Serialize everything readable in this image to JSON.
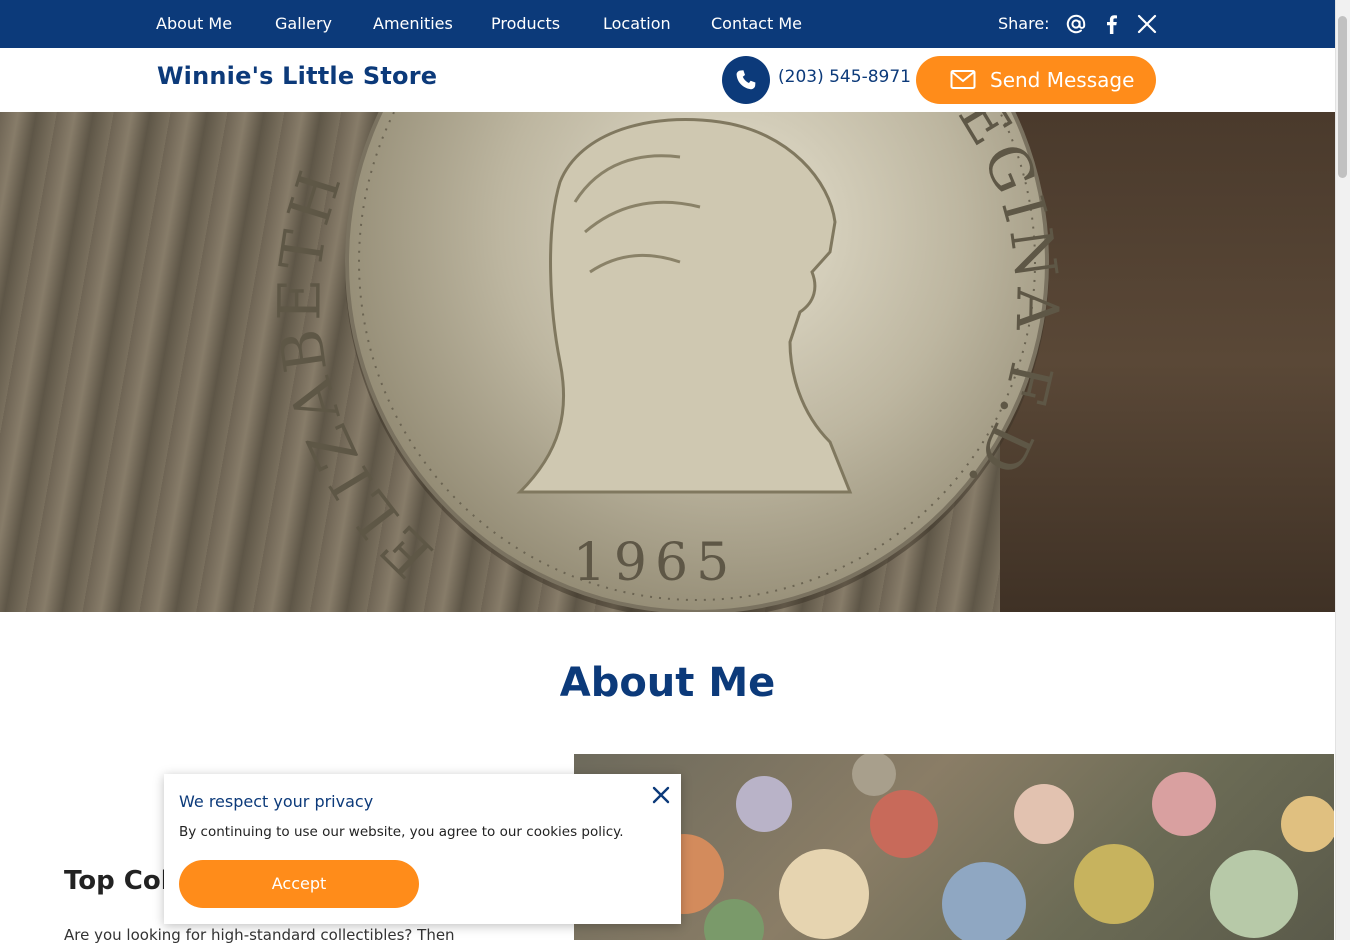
{
  "nav": {
    "items": [
      "About Me",
      "Gallery",
      "Amenities",
      "Products",
      "Location",
      "Contact Me"
    ],
    "share_label": "Share:",
    "share_icons": [
      "email-at-icon",
      "facebook-icon",
      "x-twitter-icon"
    ]
  },
  "header": {
    "brand": "Winnie's Little Store",
    "phone": "(203) 545-8971",
    "send_message": "Send Message"
  },
  "hero": {
    "coin_legend_left": "ELIZABETH",
    "coin_legend_right": "REGINA F.D.",
    "coin_year": "1965"
  },
  "about": {
    "heading": "About Me",
    "subheading": "Top Coll",
    "text": "Are you looking for high-standard collectibles? Then"
  },
  "cookie": {
    "title": "We respect your privacy",
    "text": "By continuing to use our website, you agree to our cookies policy.",
    "accept": "Accept"
  },
  "colors": {
    "brand_blue": "#0c3a7a",
    "accent_orange": "#ff8c1a"
  }
}
